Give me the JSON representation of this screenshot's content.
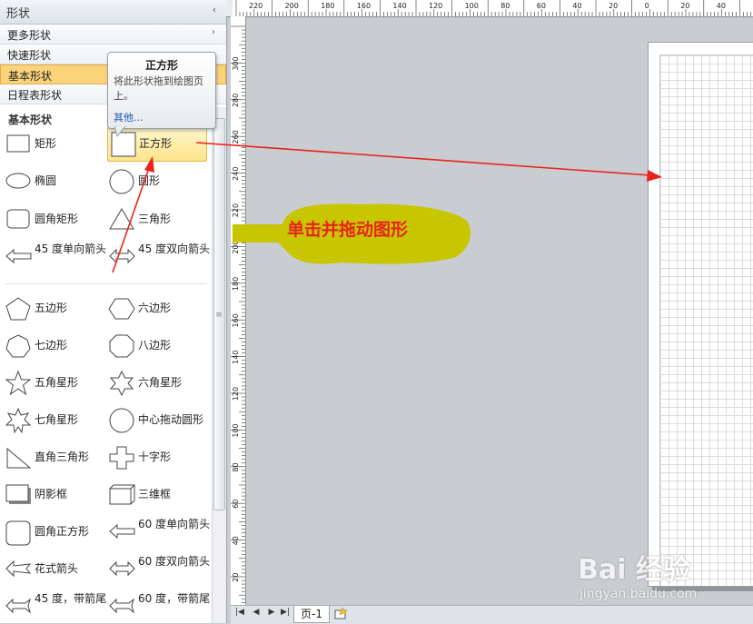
{
  "pane": {
    "title": "形状",
    "collapse": "‹",
    "categories": [
      {
        "label": "更多形状",
        "arrow": "›"
      },
      {
        "label": "快速形状"
      },
      {
        "label": "基本形状"
      },
      {
        "label": "日程表形状"
      }
    ]
  },
  "stencil": {
    "title": "基本形状",
    "items": [
      {
        "label": "矩形",
        "icon": "rectangle-icon"
      },
      {
        "label": "正方形",
        "icon": "square-icon"
      },
      {
        "label": "椭圆",
        "icon": "ellipse-icon"
      },
      {
        "label": "圆形",
        "icon": "circle-icon"
      },
      {
        "label": "圆角矩形",
        "icon": "rounded-rectangle-icon"
      },
      {
        "label": "三角形",
        "icon": "triangle-icon"
      },
      {
        "label": "45 度单向箭头",
        "icon": "arrow-left-icon"
      },
      {
        "label": "45 度双向箭头",
        "icon": "arrow-double-icon"
      },
      {
        "label": "五边形",
        "icon": "pentagon-icon"
      },
      {
        "label": "六边形",
        "icon": "hexagon-icon"
      },
      {
        "label": "七边形",
        "icon": "heptagon-icon"
      },
      {
        "label": "八边形",
        "icon": "octagon-icon"
      },
      {
        "label": "五角星形",
        "icon": "star5-icon"
      },
      {
        "label": "六角星形",
        "icon": "star6-icon"
      },
      {
        "label": "七角星形",
        "icon": "star7-icon"
      },
      {
        "label": "中心拖动圆形",
        "icon": "circle-center-icon"
      },
      {
        "label": "直角三角形",
        "icon": "right-triangle-icon"
      },
      {
        "label": "十字形",
        "icon": "cross-icon"
      },
      {
        "label": "阴影框",
        "icon": "shadow-box-icon"
      },
      {
        "label": "三维框",
        "icon": "3d-box-icon"
      },
      {
        "label": "圆角正方形",
        "icon": "rounded-square-icon"
      },
      {
        "label": "60 度单向箭头",
        "icon": "arrow-left-icon"
      },
      {
        "label": "花式箭头",
        "icon": "fancy-arrow-icon"
      },
      {
        "label": "60 度双向箭头",
        "icon": "arrow-double-icon"
      },
      {
        "label": "45 度，带箭尾",
        "icon": "arrow-tail-icon"
      },
      {
        "label": "60 度，带箭尾",
        "icon": "arrow-tail-icon"
      }
    ]
  },
  "tooltip": {
    "title": "正方形",
    "body": "将此形状拖到绘图页上。",
    "link": "其他..."
  },
  "ruler": {
    "top_labels": [
      "220",
      "200",
      "180",
      "160",
      "140",
      "120",
      "100",
      "80",
      "60",
      "40",
      "20",
      "0",
      "20",
      "40"
    ],
    "left_labels": [
      "300",
      "280",
      "260",
      "240",
      "220",
      "200",
      "180",
      "160",
      "140",
      "120",
      "100",
      "80",
      "60",
      "40",
      "20",
      "0"
    ]
  },
  "tabbar": {
    "first": "|◀",
    "prev": "◀",
    "next": "▶",
    "last": "▶|",
    "page_tab": "页-1"
  },
  "annotation": {
    "text": "单击并拖动图形",
    "arrow_color": "#e8231b",
    "highlight_color": "#c8c600"
  },
  "watermark": {
    "main": "Bai 经验",
    "sub": "jingyan.baidu.com"
  },
  "colors": {
    "selected_category": "#fbd37a",
    "canvas": "#c9ccd1"
  }
}
